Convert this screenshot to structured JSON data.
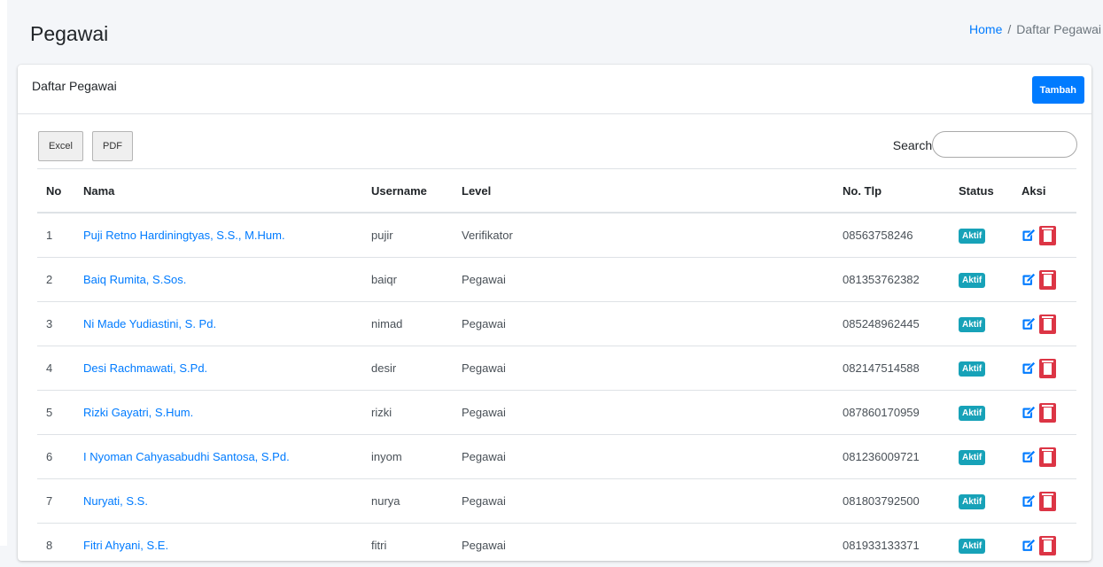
{
  "header": {
    "title": "Pegawai",
    "breadcrumb": {
      "home": "Home",
      "separator": "/",
      "current": "Daftar Pegawai"
    }
  },
  "card": {
    "title": "Daftar Pegawai",
    "add_button": "Tambah"
  },
  "toolbar": {
    "excel_label": "Excel",
    "pdf_label": "PDF",
    "search_label": "Search:",
    "search_value": ""
  },
  "table": {
    "columns": [
      "No",
      "Nama",
      "Username",
      "Level",
      "No. Tlp",
      "Status",
      "Aksi"
    ],
    "rows": [
      {
        "no": "1",
        "nama": "Puji Retno Hardiningtyas, S.S., M.Hum.",
        "username": "pujir",
        "level": "Verifikator",
        "tlp": "08563758246",
        "status": "Aktif"
      },
      {
        "no": "2",
        "nama": "Baiq Rumita, S.Sos.",
        "username": "baiqr",
        "level": "Pegawai",
        "tlp": "081353762382",
        "status": "Aktif"
      },
      {
        "no": "3",
        "nama": "Ni Made Yudiastini, S. Pd.",
        "username": "nimad",
        "level": "Pegawai",
        "tlp": "085248962445",
        "status": "Aktif"
      },
      {
        "no": "4",
        "nama": "Desi Rachmawati, S.Pd.",
        "username": "desir",
        "level": "Pegawai",
        "tlp": "082147514588",
        "status": "Aktif"
      },
      {
        "no": "5",
        "nama": "Rizki Gayatri, S.Hum.",
        "username": "rizki",
        "level": "Pegawai",
        "tlp": "087860170959",
        "status": "Aktif"
      },
      {
        "no": "6",
        "nama": "I Nyoman Cahyasabudhi Santosa, S.Pd.",
        "username": "inyom",
        "level": "Pegawai",
        "tlp": "081236009721",
        "status": "Aktif"
      },
      {
        "no": "7",
        "nama": "Nuryati, S.S.",
        "username": "nurya",
        "level": "Pegawai",
        "tlp": "081803792500",
        "status": "Aktif"
      },
      {
        "no": "8",
        "nama": "Fitri Ahyani, S.E.",
        "username": "fitri",
        "level": "Pegawai",
        "tlp": "081933133371",
        "status": "Aktif"
      }
    ]
  },
  "icons": {
    "edit": "edit-icon",
    "delete": "trash-icon"
  },
  "colors": {
    "primary": "#007bff",
    "badge": "#17a2b8",
    "danger": "#dc3545"
  }
}
